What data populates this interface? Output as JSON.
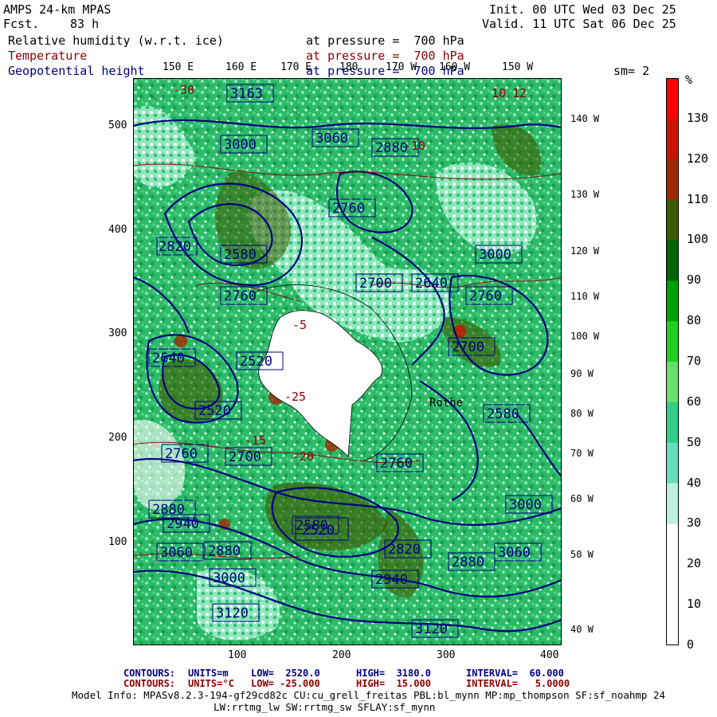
{
  "header": {
    "title": "AMPS 24-km MPAS",
    "fcst_label": "Fcst.",
    "fcst_value": "83 h",
    "init": "Init. 00 UTC Wed 03 Dec 25",
    "valid": "Valid. 11 UTC Sat 06 Dec 25",
    "field1_name": "Relative humidity (w.r.t. ice)",
    "field1_level": "at pressure =  700 hPa",
    "field2_name": "Temperature",
    "field2_level": "at pressure =  700 hPa",
    "field3_name": "Geopotential height",
    "field3_level": "at pressure =  700 hPa",
    "smoothing": "sm= 2"
  },
  "map": {
    "top_longitudes": [
      "150 E",
      "160 E",
      "170 E",
      "180",
      "170 W",
      "160 W",
      "150 W"
    ],
    "right_longitudes": [
      "140 W",
      "130 W",
      "120 W",
      "110 W",
      "100 W",
      "90 W",
      "80 W",
      "70 W",
      "60 W",
      "50 W",
      "40 W"
    ],
    "y_ticks": [
      "500",
      "400",
      "300",
      "200",
      "100"
    ],
    "x_ticks": [
      "100",
      "200",
      "300",
      "400"
    ],
    "height_labels": [
      "3163",
      "3060",
      "3000",
      "2880",
      "2820",
      "2760",
      "2700",
      "2640",
      "2580",
      "2520",
      "2940",
      "3120",
      "3060",
      "3000",
      "2880",
      "2760",
      "2700",
      "2640",
      "2580",
      "2520",
      "2880",
      "2820",
      "2760",
      "2700",
      "3000",
      "2760",
      "2700",
      "3000",
      "3060",
      "3120",
      "2940",
      "2880",
      "2760",
      "2700",
      "2820",
      "2580",
      "2520",
      "2760",
      "2880",
      "2940",
      "2820",
      "3060"
    ],
    "temp_labels": [
      "-30",
      "-25",
      "-20",
      "-15",
      "-10",
      "-5",
      "10",
      "12"
    ],
    "place_label": "Rothe"
  },
  "colorbar": {
    "unit": "%",
    "labels": [
      "130",
      "120",
      "110",
      "100",
      "90",
      "80",
      "70",
      "60",
      "50",
      "40",
      "30",
      "20",
      "10",
      "0"
    ],
    "colors": [
      "#ff0000",
      "#c81400",
      "#a02800",
      "#3c5a00",
      "#006400",
      "#00a000",
      "#20d020",
      "#66e066",
      "#33cc88",
      "#66ddbb",
      "#bbf0dd",
      "#ffffff",
      "#ffffff",
      "#ffffff"
    ]
  },
  "footer": {
    "line1_label": "CONTOURS:",
    "line1_units": "UNITS=m",
    "line1_low": "LOW=  2520.0",
    "line1_high": "HIGH=  3180.0",
    "line1_interval": "INTERVAL=  60.000",
    "line2_label": "CONTOURS:",
    "line2_units": "UNITS=°C",
    "line2_low": "LOW= -25.000",
    "line2_high": "HIGH=  15.000",
    "line2_interval": "INTERVAL=   5.0000",
    "model_info": "Model Info: MPASv8.2.3-194-gf29cd82c CU:cu_grell_freitas PBL:bl_mynn MP:mp_thompson SF:sf_noahmp 24",
    "model_info2": "LW:rrtmg_lw SW:rrtmg_sw SFLAY:sf_mynn"
  }
}
